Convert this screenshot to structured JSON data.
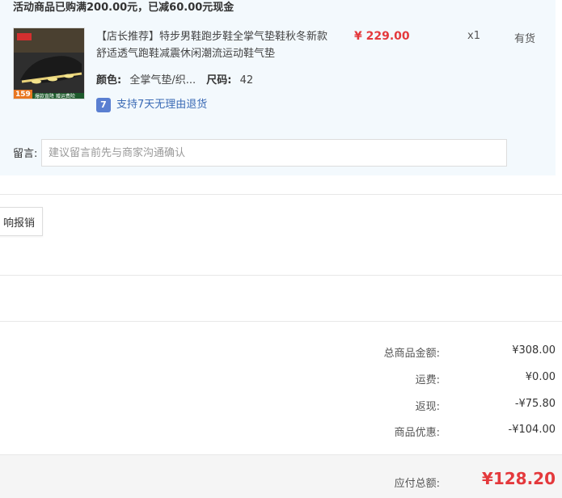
{
  "promo": {
    "text": "活动商品已购满200.00元，已减60.00元现金"
  },
  "item": {
    "image_overlay": "159",
    "image_strip": "爆款直降 赠运费险",
    "title": "【店长推荐】特步男鞋跑步鞋全掌气垫鞋秋冬新款舒适透气跑鞋减震休闲潮流运动鞋气垫",
    "price": "¥ 229.00",
    "qty": "x1",
    "stock": "有货",
    "color_label": "颜色:",
    "color_value": "全掌气垫/织...",
    "size_label": "尺码:",
    "size_value": "42",
    "returns_badge": "7",
    "returns_text": "支持7天无理由退货"
  },
  "message": {
    "label": "留言:",
    "placeholder": "建议留言前先与商家沟通确认"
  },
  "expense_button": "响报销",
  "summary": {
    "rows": [
      {
        "label": "总商品金额:",
        "value": "¥308.00"
      },
      {
        "label": "运费:",
        "value": "¥0.00"
      },
      {
        "label": "返现:",
        "value": "-¥75.80"
      },
      {
        "label": "商品优惠:",
        "value": "-¥104.00"
      }
    ],
    "total_label": "应付总额:",
    "total_value": "¥128.20"
  },
  "colors": {
    "accent": "#e4393c",
    "panel_bg": "#f3f9fd",
    "link": "#3b6bb5"
  }
}
